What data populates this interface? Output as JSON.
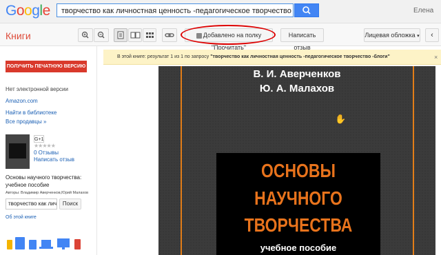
{
  "header": {
    "logo": "Google",
    "search_query": "творчество как личностная ценность -педагогическое творчество -блоги",
    "user_name": "Елена"
  },
  "toolbar": {
    "section_title": "Книги",
    "shelf_label": "Добавлено на полку \"Прочитать\"",
    "review_label": "Написать отзыв",
    "cover_label": "Лицевая обложка"
  },
  "notice": {
    "prefix": "В этой книге: результат 1 из 1 по запросу ",
    "query": "\"творчество как личностная ценность -педагогическое творчество -блоги\""
  },
  "sidebar": {
    "buy_label": "ПОЛУЧИТЬ ПЕЧАТНУЮ ВЕРСИЮ",
    "no_ebook": "Нет электронной версии",
    "store": "Amazon.com",
    "library": "Найти в библиотеке",
    "all_sellers": "Все продавцы »",
    "gplus": "G+1",
    "stars": "★★★★★",
    "reviews": "0 Отзывы",
    "write_review": "Написать отзыв",
    "book_title_1": "Основы научного творчества:",
    "book_title_2": "учебное пособие",
    "authors": "Авторы: Владимир Аверченков,Юрий Малахов",
    "search_value": "творчество как личн",
    "search_button": "Поиск",
    "about": "Об этой книге"
  },
  "cover": {
    "author1": "В. И. Аверченков",
    "author2": "Ю. А. Малахов",
    "title_line1": "ОСНОВЫ",
    "title_line2": "НАУЧНОГО",
    "title_line3": "ТВОРЧЕСТВА",
    "subtitle": "учебное пособие"
  },
  "colors": {
    "accent_red": "#dd4b39",
    "search_blue": "#4285f4",
    "cover_orange": "#e8731c"
  }
}
